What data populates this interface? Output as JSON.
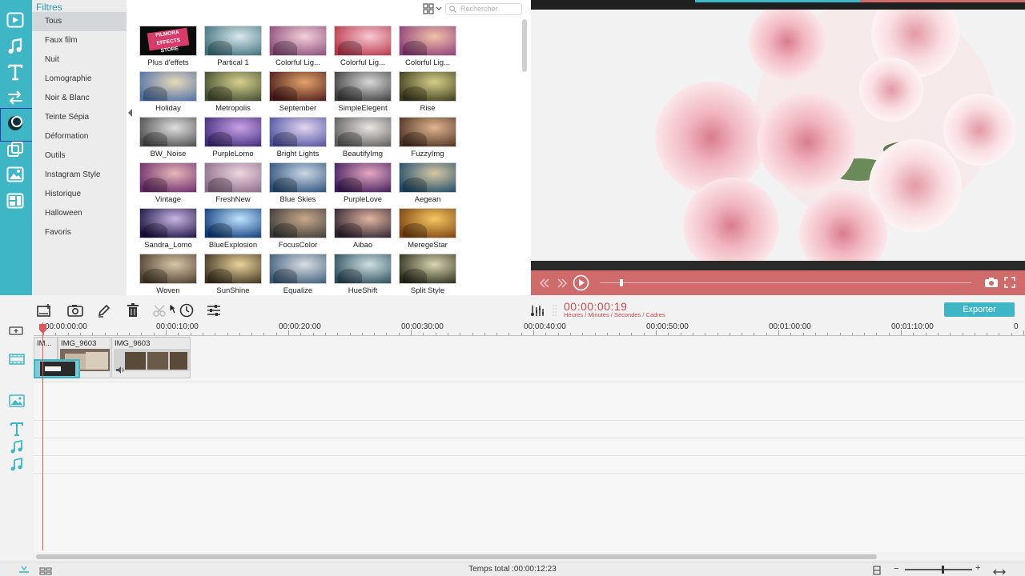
{
  "sidebar": {
    "title": "Filtres",
    "categories": [
      "Tous",
      "Faux film",
      "Nuit",
      "Lomographie",
      "Noir & Blanc",
      "Teinte Sépia",
      "Déformation",
      "Outils",
      "Instagram Style",
      "Historique",
      "Halloween",
      "Favoris"
    ],
    "active": "Tous"
  },
  "search": {
    "placeholder": "Rechercher"
  },
  "filters": [
    {
      "label": "Plus d'effets",
      "badge_top": "FILMORA",
      "badge_bottom": "EFFECTS STORE",
      "colors": [
        "#0a0a0a",
        "#1a1a1a"
      ]
    },
    {
      "label": "Partical 1",
      "colors": [
        "#3c6f7a",
        "#d9e9ee"
      ]
    },
    {
      "label": "Colorful Lig...",
      "colors": [
        "#8a4a7a",
        "#f3d0d8"
      ]
    },
    {
      "label": "Colorful Lig...",
      "colors": [
        "#b8344a",
        "#f6c9d2"
      ]
    },
    {
      "label": "Colorful Lig...",
      "colors": [
        "#8d3b7a",
        "#f1c2a8"
      ]
    },
    {
      "label": "Holiday",
      "colors": [
        "#4a6fa8",
        "#e8d9b8"
      ]
    },
    {
      "label": "Metropolis",
      "colors": [
        "#3f4a2c",
        "#d7d18f"
      ]
    },
    {
      "label": "September",
      "colors": [
        "#4a1a1a",
        "#e2a36a"
      ]
    },
    {
      "label": "SimpleElegent",
      "colors": [
        "#3a3a3a",
        "#d8d8d8"
      ]
    },
    {
      "label": "Rise",
      "colors": [
        "#3a3a1c",
        "#d6cf88"
      ]
    },
    {
      "label": "BW_Noise",
      "colors": [
        "#4a4a4a",
        "#e0e0e0"
      ]
    },
    {
      "label": "PurpleLomo",
      "colors": [
        "#3e2a7a",
        "#c9a2e6"
      ]
    },
    {
      "label": "Bright Lights",
      "colors": [
        "#4b4fa0",
        "#e3d6f0"
      ]
    },
    {
      "label": "BeautifyImg",
      "colors": [
        "#5a5a5a",
        "#ebe6e3"
      ]
    },
    {
      "label": "FuzzyImg",
      "colors": [
        "#4a3020",
        "#e2b58f"
      ]
    },
    {
      "label": "Vintage",
      "colors": [
        "#6a2a6a",
        "#e6b7b9"
      ]
    },
    {
      "label": "FreshNew",
      "colors": [
        "#8a6a8a",
        "#eed7de"
      ]
    },
    {
      "label": "Blue Skies",
      "colors": [
        "#2a4e78",
        "#cbd8e6"
      ]
    },
    {
      "label": "PurpleLove",
      "colors": [
        "#3e1a5a",
        "#e4a8c2"
      ]
    },
    {
      "label": "Aegean",
      "colors": [
        "#1c4a6a",
        "#d7c8a2"
      ]
    },
    {
      "label": "Sandra_Lomo",
      "colors": [
        "#1a1040",
        "#c7b6e4"
      ]
    },
    {
      "label": "BlueExplosion",
      "colors": [
        "#0c3a78",
        "#bfe4ff"
      ]
    },
    {
      "label": "FocusColor",
      "colors": [
        "#3a3a3a",
        "#c9a88a"
      ]
    },
    {
      "label": "Aibao",
      "colors": [
        "#2a2030",
        "#e2b5a0"
      ]
    },
    {
      "label": "MeregeStar",
      "colors": [
        "#7a4010",
        "#f5c860"
      ]
    },
    {
      "label": "Woven",
      "colors": [
        "#4a3a2a",
        "#d8c6a8"
      ]
    },
    {
      "label": "SunShine",
      "colors": [
        "#3a3020",
        "#ead39a"
      ]
    },
    {
      "label": "Equalize",
      "colors": [
        "#3a5a78",
        "#dadfe4"
      ]
    },
    {
      "label": "HueShift",
      "colors": [
        "#2a4a5a",
        "#cfe0e2"
      ]
    },
    {
      "label": "Split Style",
      "colors": [
        "#2a2a1a",
        "#d8d5b0"
      ]
    }
  ],
  "toolbar": {
    "timecode": "00:00:00:19",
    "timecode_hint": "Heures / Minutes / Secondes / Cadres",
    "export_label": "Exporter"
  },
  "ruler": {
    "marks": [
      "00:00:00:00",
      "00:00:10:00",
      "00:00:20:00",
      "00:00:30:00",
      "00:00:40:00",
      "00:00:50:00",
      "00:01:00:00",
      "00:01:10:00",
      "0"
    ]
  },
  "timeline": {
    "clips": [
      {
        "label": "IM..."
      },
      {
        "label": "IMG_9603"
      },
      {
        "label": "IMG_9603"
      }
    ]
  },
  "footer": {
    "total_label": "Temps total :00:00:12:23"
  },
  "colors": {
    "accent": "#3fb6c6",
    "timecode": "#c84a4a",
    "player_bar": "#cf6b6b"
  }
}
